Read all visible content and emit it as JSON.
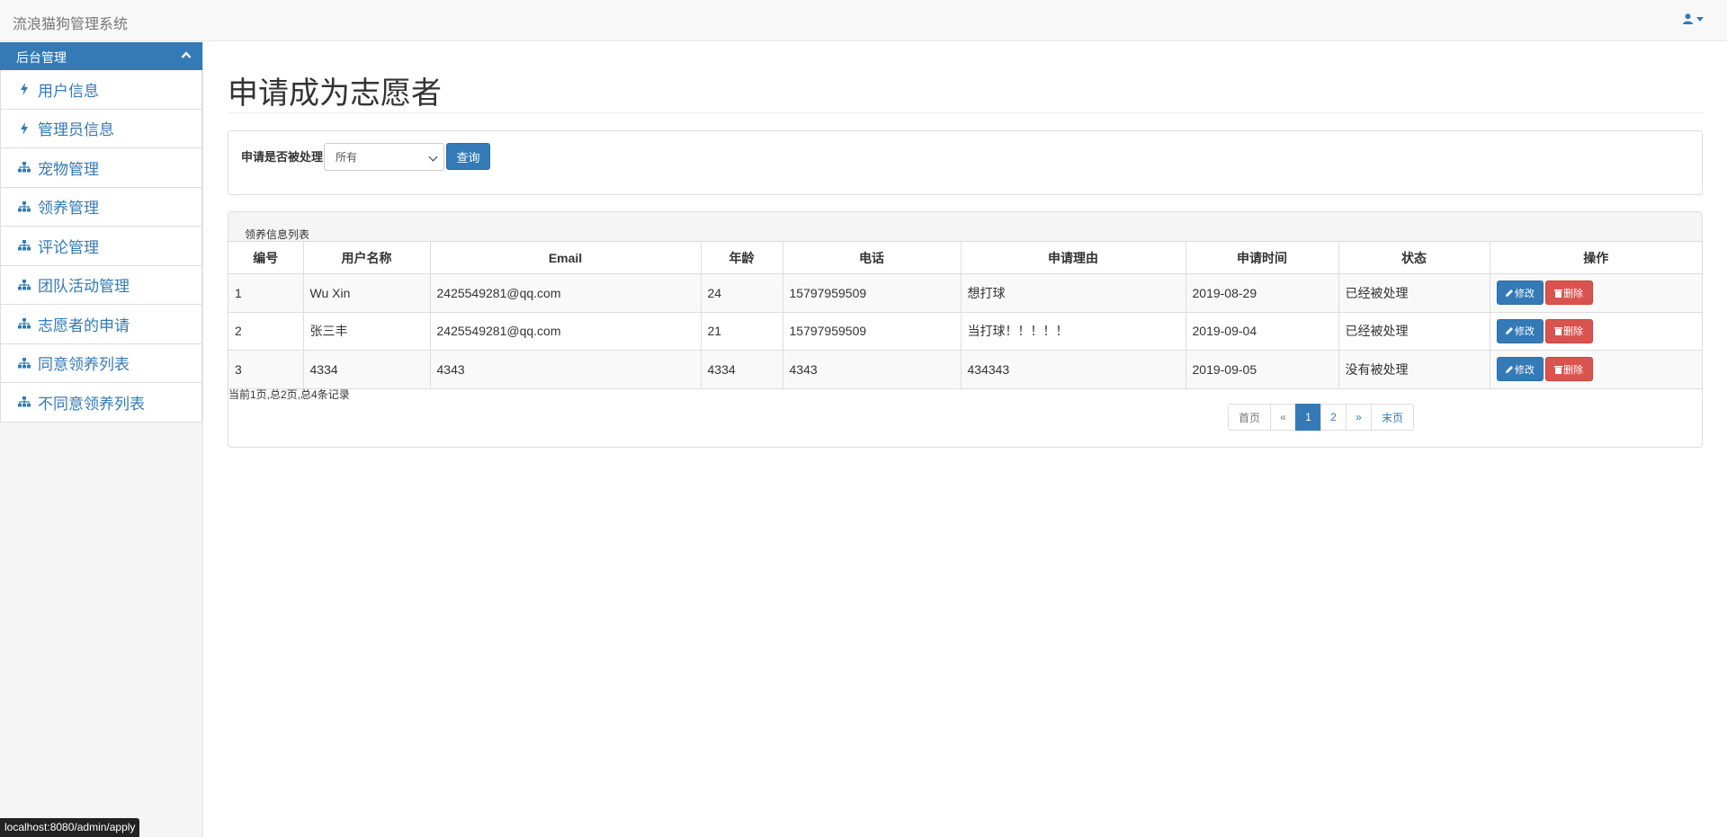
{
  "app": {
    "brand": "流浪猫狗管理系统"
  },
  "sidebar": {
    "header": "后台管理",
    "items": [
      {
        "label": "用户信息",
        "icon": "bolt-icon"
      },
      {
        "label": "管理员信息",
        "icon": "bolt-icon"
      },
      {
        "label": "宠物管理",
        "icon": "sitemap-icon"
      },
      {
        "label": "领养管理",
        "icon": "sitemap-icon"
      },
      {
        "label": "评论管理",
        "icon": "sitemap-icon"
      },
      {
        "label": "团队活动管理",
        "icon": "sitemap-icon"
      },
      {
        "label": "志愿者的申请",
        "icon": "sitemap-icon"
      },
      {
        "label": "同意领养列表",
        "icon": "sitemap-icon"
      },
      {
        "label": "不同意领养列表",
        "icon": "sitemap-icon"
      }
    ]
  },
  "main": {
    "title": "申请成为志愿者",
    "filter": {
      "label": "申请是否被处理",
      "selected": "所有",
      "query_label": "查询"
    },
    "list": {
      "title": "领养信息列表",
      "columns": [
        "编号",
        "用户名称",
        "Email",
        "年龄",
        "电话",
        "申请理由",
        "申请时间",
        "状态",
        "操作"
      ],
      "rows": [
        {
          "id": "1",
          "name": "Wu Xin",
          "email": "2425549281@qq.com",
          "age": "24",
          "phone": "15797959509",
          "reason": "想打球",
          "time": "2019-08-29",
          "status": "已经被处理"
        },
        {
          "id": "2",
          "name": "张三丰",
          "email": "2425549281@qq.com",
          "age": "21",
          "phone": "15797959509",
          "reason": "当打球！！！！！",
          "time": "2019-09-04",
          "status": "已经被处理"
        },
        {
          "id": "3",
          "name": "4334",
          "email": "4343",
          "age": "4334",
          "phone": "4343",
          "reason": "434343",
          "time": "2019-09-05",
          "status": "没有被处理"
        }
      ],
      "edit_label": "修改",
      "delete_label": "删除",
      "record_info": "当前1页,总2页,总4条记录"
    },
    "pagination": [
      "首页",
      "«",
      "1",
      "2",
      "»",
      "末页"
    ],
    "pagination_active": "1"
  },
  "statusbar": {
    "url": "localhost:8080/admin/apply"
  },
  "colors": {
    "primary": "#337ab7",
    "danger": "#d9534f"
  }
}
